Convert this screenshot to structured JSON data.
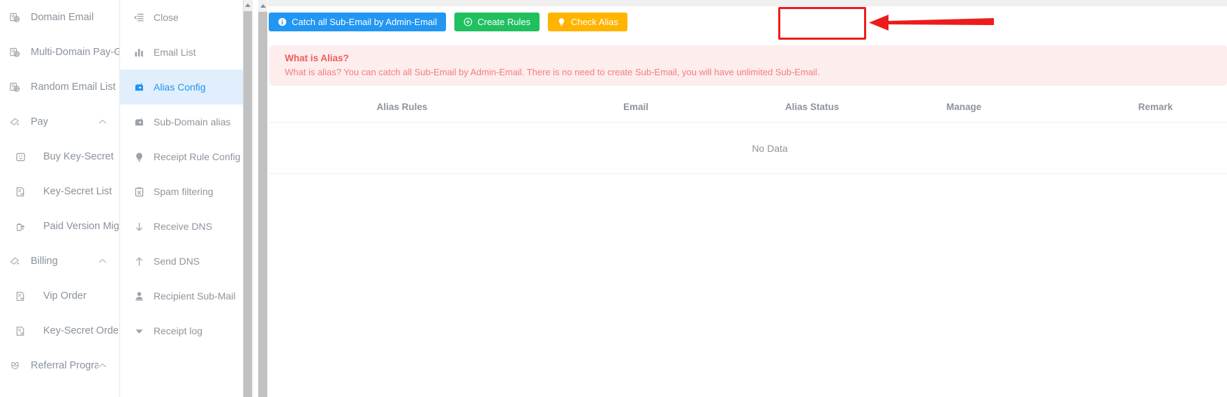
{
  "sidebar": {
    "items": [
      {
        "label": "Domain Email",
        "icon": "domain-email-icon",
        "level": "top",
        "expandable": false,
        "arrow": ""
      },
      {
        "label": "Multi-Domain Pay-Group",
        "icon": "domain-email-icon",
        "level": "top",
        "expandable": false,
        "arrow": ""
      },
      {
        "label": "Random Email List",
        "icon": "domain-email-icon",
        "level": "top",
        "expandable": false,
        "arrow": ""
      },
      {
        "label": "Pay",
        "icon": "pay-icon",
        "level": "top",
        "expandable": true,
        "arrow": "chevron-up-icon"
      },
      {
        "label": "Buy Key-Secret",
        "icon": "wallet-icon",
        "level": "child",
        "expandable": false,
        "arrow": ""
      },
      {
        "label": "Key-Secret List",
        "icon": "document-list-icon",
        "level": "child",
        "expandable": false,
        "arrow": ""
      },
      {
        "label": "Paid Version Migration",
        "icon": "upgrade-icon",
        "level": "child",
        "expandable": false,
        "arrow": ""
      },
      {
        "label": "Billing",
        "icon": "pay-icon",
        "level": "top",
        "expandable": true,
        "arrow": "chevron-up-icon"
      },
      {
        "label": "Vip Order",
        "icon": "document-list-icon",
        "level": "child",
        "expandable": false,
        "arrow": ""
      },
      {
        "label": "Key-Secret Order",
        "icon": "document-list-icon",
        "level": "child",
        "expandable": false,
        "arrow": ""
      },
      {
        "label": "Referral Program",
        "icon": "gift-icon",
        "level": "top",
        "expandable": true,
        "arrow": "chevron-up-icon"
      }
    ]
  },
  "secondary_menu": {
    "items": [
      {
        "label": "Close",
        "icon": "collapse-menu-icon",
        "active": false
      },
      {
        "label": "Email List",
        "icon": "bar-chart-icon",
        "active": false
      },
      {
        "label": "Alias Config",
        "icon": "mailbox-icon",
        "active": true
      },
      {
        "label": "Sub-Domain alias",
        "icon": "mailbox-icon",
        "active": false
      },
      {
        "label": "Receipt Rule Config",
        "icon": "bulb-icon",
        "active": false
      },
      {
        "label": "Spam filtering",
        "icon": "spam-clipboard-icon",
        "active": false
      },
      {
        "label": "Receive DNS",
        "icon": "arrow-down-icon",
        "active": false
      },
      {
        "label": "Send DNS",
        "icon": "arrow-up-icon",
        "active": false
      },
      {
        "label": "Recipient Sub-Mail",
        "icon": "user-icon",
        "active": false
      },
      {
        "label": "Receipt log",
        "icon": "caret-down-icon",
        "active": false
      }
    ]
  },
  "toolbar": {
    "catch_all_label": "Catch all Sub-Email by Admin-Email",
    "catch_all_icon": "info-circle-icon",
    "catch_all_color": "#2196f3",
    "create_rules_label": "Create Rules",
    "create_rules_icon": "plus-circle-icon",
    "create_rules_color": "#20c05f",
    "check_alias_label": "Check Alias",
    "check_alias_icon": "bulb-icon",
    "check_alias_color": "#ffb400"
  },
  "annotation": {
    "color": "#ee1b1b",
    "target": "check-alias-button"
  },
  "alert": {
    "title": "What is Alias?",
    "description": "What is alias? You can catch all Sub-Email by Admin-Email. There is no need to create Sub-Email, you will have unlimited Sub-Email.",
    "background": "#feeded",
    "text_color": "#f56c6c"
  },
  "table": {
    "columns": [
      "Alias Rules",
      "Email",
      "Alias Status",
      "Manage",
      "Remark"
    ],
    "rows": [],
    "empty_text": "No Data"
  }
}
